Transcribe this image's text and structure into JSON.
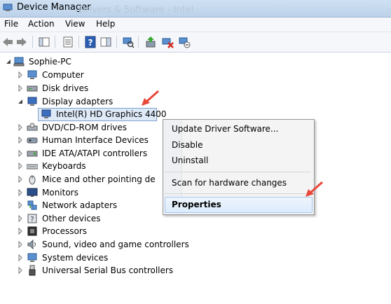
{
  "window": {
    "title": "Device Manager",
    "background_title": "Drivers & Software - Intel"
  },
  "menu": [
    "File",
    "Action",
    "View",
    "Help"
  ],
  "toolbar_icons": [
    "back-arrow-icon",
    "forward-arrow-icon",
    "show-hide-console-tree-icon",
    "properties-icon",
    "help-icon",
    "action-pane-icon",
    "scan-hardware-icon",
    "update-driver-icon",
    "uninstall-icon",
    "disable-icon"
  ],
  "tree": {
    "root": "Sophie-PC",
    "items": [
      {
        "label": "Computer",
        "expanded": false
      },
      {
        "label": "Disk drives",
        "expanded": false
      },
      {
        "label": "Display adapters",
        "expanded": true
      },
      {
        "label": "Intel(R) HD Graphics 4400",
        "child": true,
        "selected": true
      },
      {
        "label": "DVD/CD-ROM drives",
        "expanded": false
      },
      {
        "label": "Human Interface Devices",
        "expanded": false
      },
      {
        "label": "IDE ATA/ATAPI controllers",
        "expanded": false
      },
      {
        "label": "Keyboards",
        "expanded": false
      },
      {
        "label": "Mice and other pointing de",
        "expanded": false
      },
      {
        "label": "Monitors",
        "expanded": false
      },
      {
        "label": "Network adapters",
        "expanded": false
      },
      {
        "label": "Other devices",
        "expanded": false
      },
      {
        "label": "Processors",
        "expanded": false
      },
      {
        "label": "Sound, video and game controllers",
        "expanded": false
      },
      {
        "label": "System devices",
        "expanded": false
      },
      {
        "label": "Universal Serial Bus controllers",
        "expanded": false
      }
    ]
  },
  "context_menu": {
    "update": "Update Driver Software...",
    "disable": "Disable",
    "uninstall": "Uninstall",
    "scan": "Scan for hardware changes",
    "properties": "Properties"
  },
  "colors": {
    "selection": "#dfeaf8",
    "annotation_arrow": "#e8483a"
  }
}
